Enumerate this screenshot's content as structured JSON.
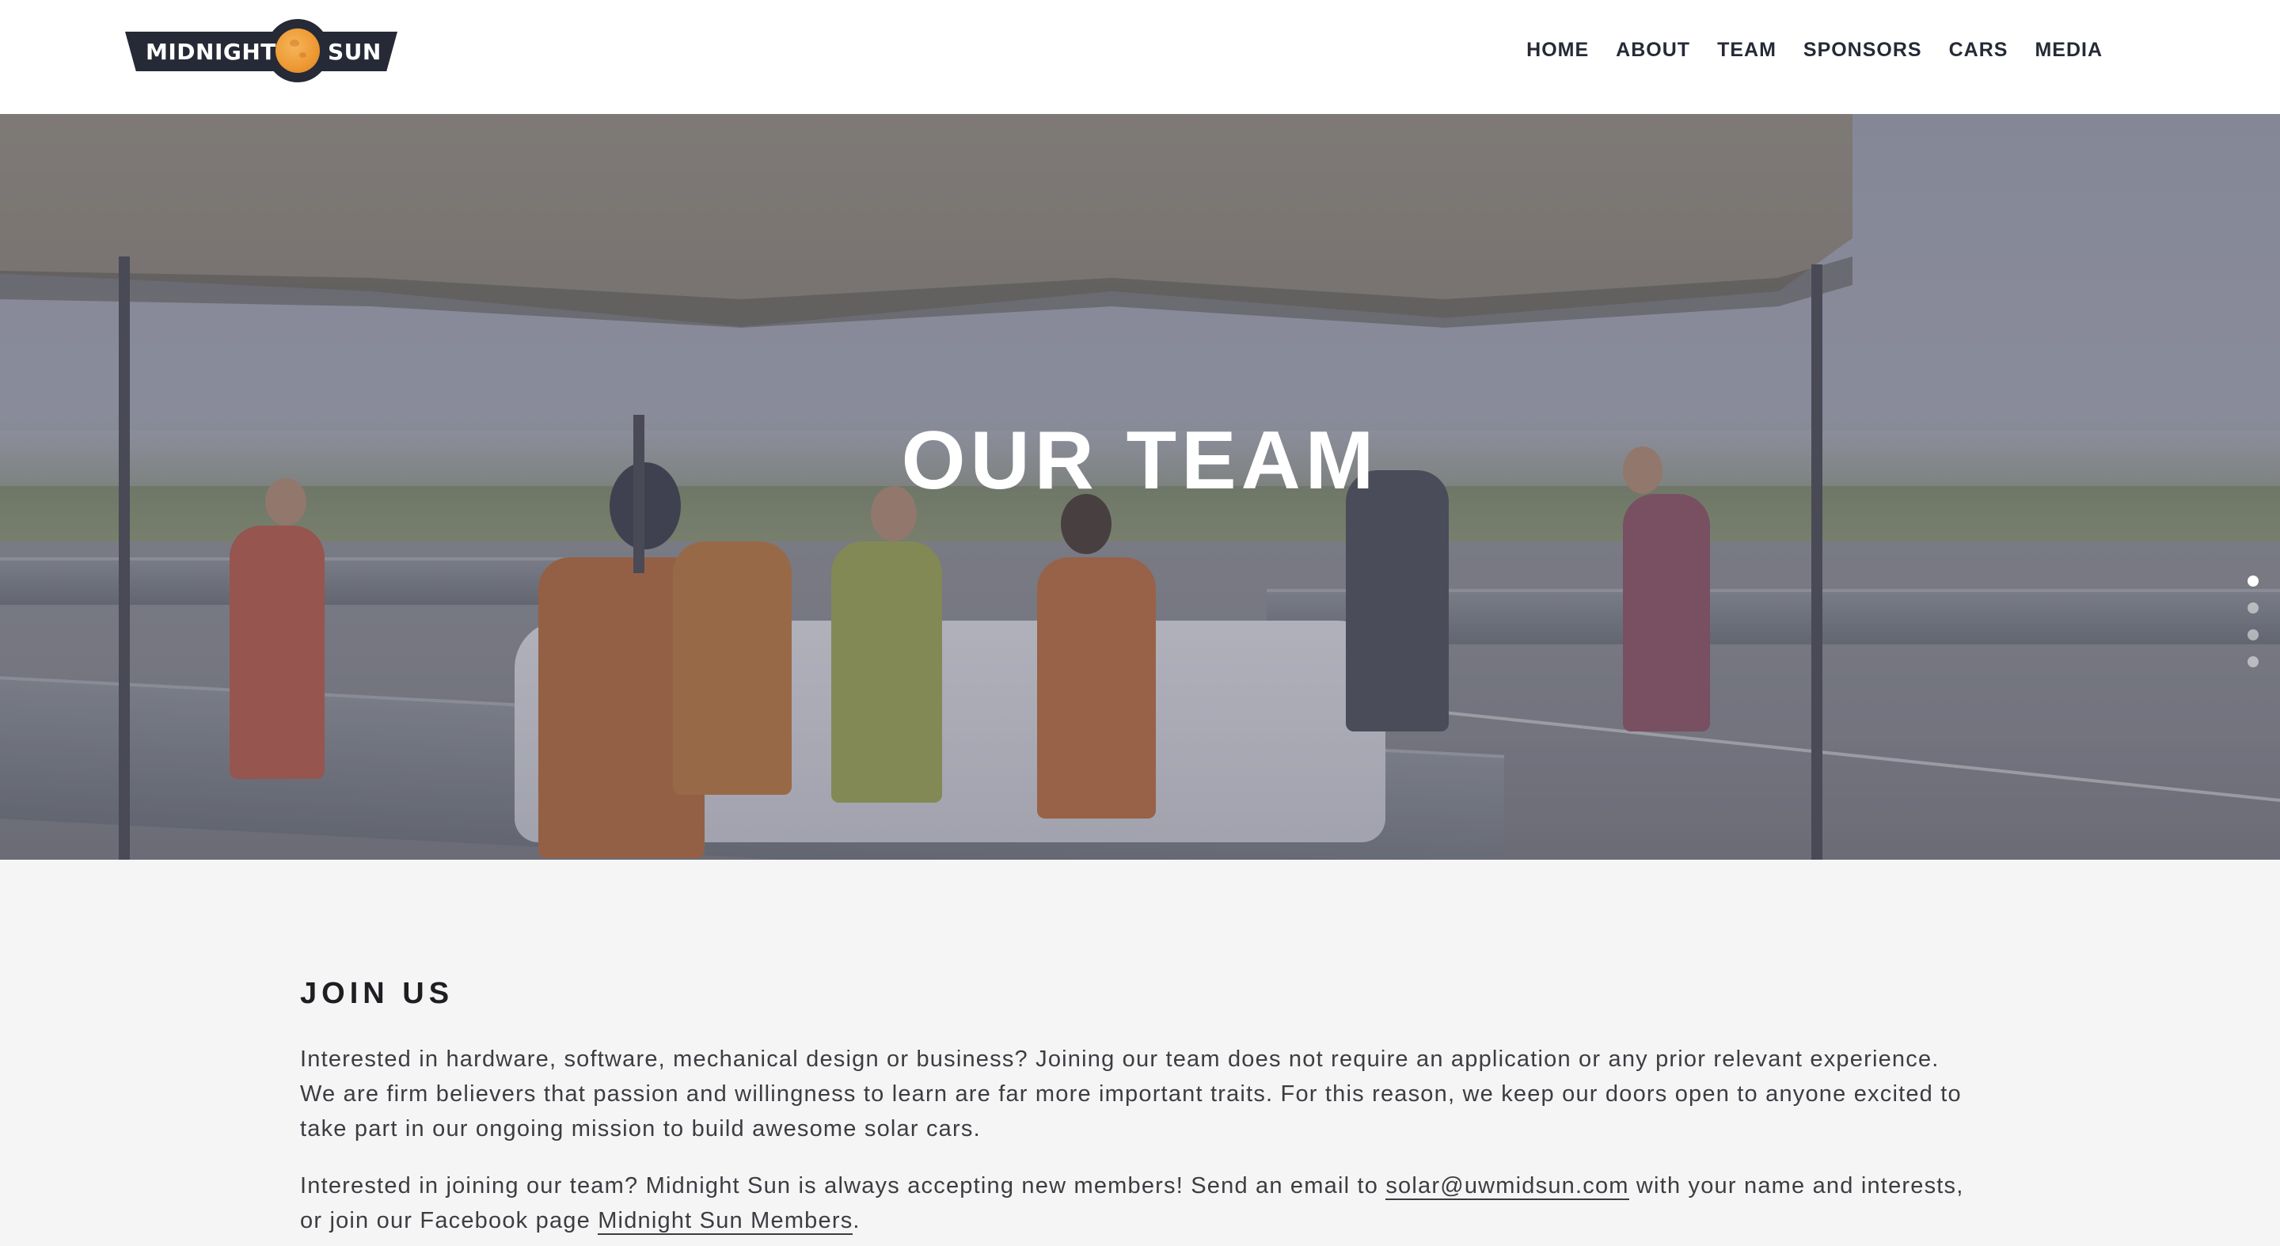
{
  "logo": {
    "left_word": "MIDNIGHT",
    "right_word": "SUN"
  },
  "nav": {
    "items": [
      {
        "label": "HOME"
      },
      {
        "label": "ABOUT"
      },
      {
        "label": "TEAM"
      },
      {
        "label": "SPONSORS"
      },
      {
        "label": "CARS"
      },
      {
        "label": "MEDIA"
      }
    ]
  },
  "hero": {
    "title": "OUR TEAM",
    "slide_count": 4,
    "active_slide": 1
  },
  "join": {
    "heading": "JOIN US",
    "paragraph1": "Interested in hardware, software, mechanical design or business? Joining our team does not require an application or any prior relevant experience. We are firm believers that passion and willingness to learn are far more important traits. For this reason, we keep our doors open to anyone excited to take part in our ongoing mission to build awesome solar cars.",
    "paragraph2_prefix": "Interested in joining our team? Midnight Sun is always accepting new members! Send an email to ",
    "email_link": "solar@uwmidsun.com",
    "paragraph2_middle": " with your name and interests, or join our Facebook page ",
    "facebook_link": "Midnight Sun Members",
    "paragraph2_suffix": "."
  },
  "colors": {
    "header_bg": "#ffffff",
    "nav_text": "#252a36",
    "logo_plate": "#252a36",
    "logo_sun": "#ee9b35",
    "content_bg": "#f5f5f5",
    "body_text": "#3c3c42"
  }
}
